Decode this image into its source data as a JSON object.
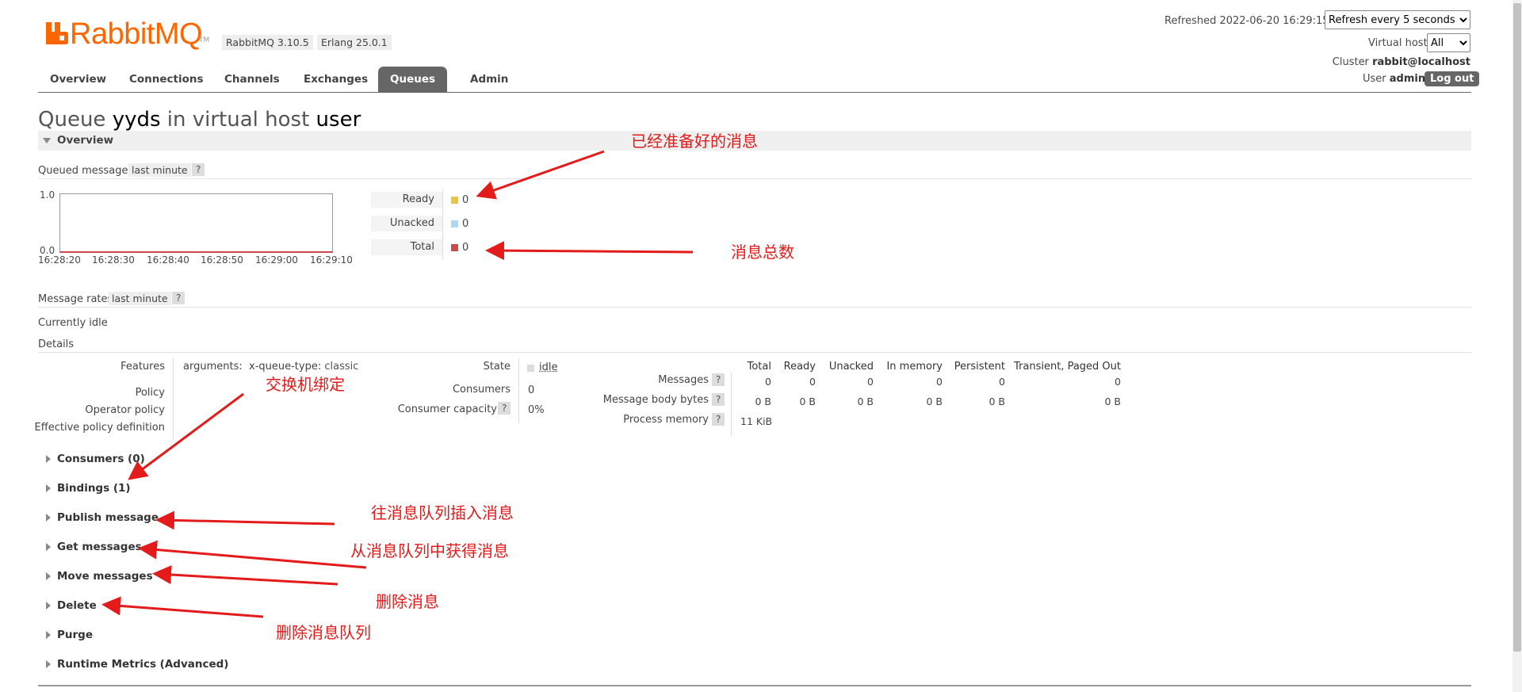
{
  "header": {
    "logo_text": "RabbitMQ",
    "logo_tm": "TM",
    "rabbitmq_version": "RabbitMQ 3.10.5",
    "erlang_version": "Erlang 25.0.1",
    "refreshed_label": "Refreshed 2022-06-20 16:29:15",
    "refresh_select": "Refresh every 5 seconds",
    "virtual_host_label": "Virtual host",
    "virtual_host_value": "All",
    "cluster_label": "Cluster",
    "cluster_value": "rabbit@localhost",
    "user_label": "User",
    "user_value": "admin",
    "logout": "Log out"
  },
  "nav": {
    "tabs": [
      {
        "label": "Overview"
      },
      {
        "label": "Connections"
      },
      {
        "label": "Channels"
      },
      {
        "label": "Exchanges"
      },
      {
        "label": "Queues",
        "active": true
      },
      {
        "label": "Admin"
      }
    ]
  },
  "page": {
    "title_prefix": "Queue",
    "queue_name": "yyds",
    "title_mid": "in virtual host",
    "vhost": "user"
  },
  "overview": {
    "section_title": "Overview",
    "queued_label": "Queued messages",
    "queued_range": "last minute",
    "help": "?",
    "chart_ymax": "1.0",
    "chart_ymin": "0.0",
    "chart_xticks": [
      "16:28:20",
      "16:28:30",
      "16:28:40",
      "16:28:50",
      "16:29:00",
      "16:29:10"
    ],
    "legend": [
      {
        "label": "Ready",
        "value": "0",
        "color": "#edc240"
      },
      {
        "label": "Unacked",
        "value": "0",
        "color": "#afd8f8"
      },
      {
        "label": "Total",
        "value": "0",
        "color": "#cb4b4b"
      }
    ],
    "rates_label": "Message rates",
    "rates_range": "last minute",
    "idle_text": "Currently idle",
    "details_label": "Details"
  },
  "details": {
    "features_label": "Features",
    "arguments_label": "arguments:",
    "queue_type_key": "x-queue-type:",
    "queue_type_value": "classic",
    "policy_label": "Policy",
    "operator_policy_label": "Operator policy",
    "effective_policy_label": "Effective policy definition",
    "state_label": "State",
    "state_value": "idle",
    "consumers_label": "Consumers",
    "consumers_value": "0",
    "capacity_label": "Consumer capacity",
    "capacity_value": "0%",
    "stats_headers": [
      "Total",
      "Ready",
      "Unacked",
      "In memory",
      "Persistent",
      "Transient, Paged Out"
    ],
    "messages_label": "Messages",
    "messages_values": [
      "0",
      "0",
      "0",
      "0",
      "0",
      "0"
    ],
    "body_bytes_label": "Message body bytes",
    "body_bytes_values": [
      "0 B",
      "0 B",
      "0 B",
      "0 B",
      "0 B",
      "0 B"
    ],
    "process_memory_label": "Process memory",
    "process_memory_value": "11 KiB"
  },
  "sections": [
    {
      "label": "Consumers (0)"
    },
    {
      "label": "Bindings (1)"
    },
    {
      "label": "Publish message"
    },
    {
      "label": "Get messages"
    },
    {
      "label": "Move messages"
    },
    {
      "label": "Delete"
    },
    {
      "label": "Purge"
    },
    {
      "label": "Runtime Metrics (Advanced)"
    }
  ],
  "annotations": {
    "ready_note": "已经准备好的消息",
    "total_note": "消息总数",
    "bindings_note": "交换机绑定",
    "publish_note": "往消息队列插入消息",
    "get_note": "从消息队列中获得消息",
    "delete_msg_note": "删除消息",
    "delete_queue_note": "删除消息队列"
  },
  "colors": {
    "brand": "#ff6600",
    "nav_active": "#666666",
    "annotation": "#e31b1b"
  }
}
